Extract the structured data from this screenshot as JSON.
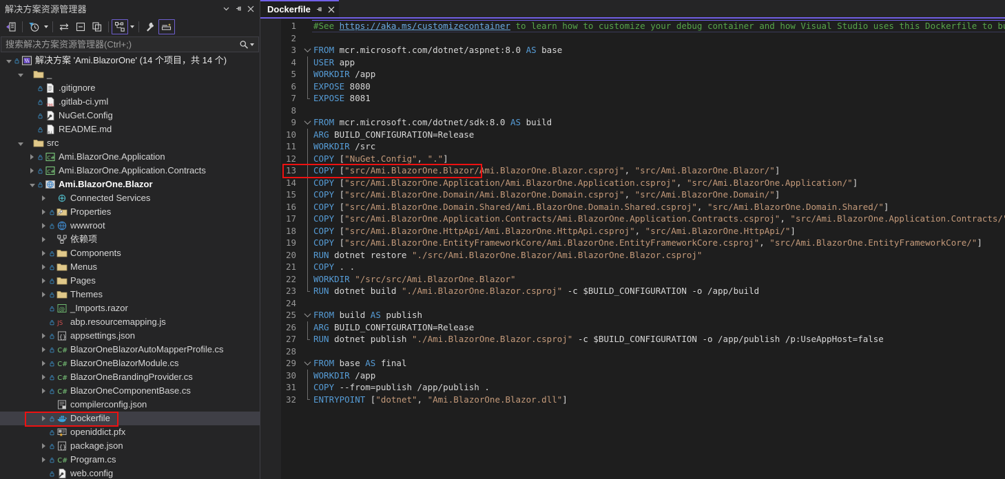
{
  "solution_explorer": {
    "title": "解决方案资源管理器",
    "titlebar_buttons": [
      {
        "name": "dropdown-icon",
        "glyph": "▾"
      },
      {
        "name": "pin-icon",
        "glyph": "⇥"
      },
      {
        "name": "close-icon",
        "glyph": "✕"
      }
    ],
    "toolbar": [
      {
        "name": "back-navigate-icon",
        "label": "后退"
      },
      {
        "name": "pending-changes-icon",
        "label": "挂起的更改筛选器"
      },
      {
        "name": "pending-changes-caret",
        "label": "筛选器下拉"
      },
      {
        "name": "sync-with-active-document-icon",
        "label": "与活动文档同步"
      },
      {
        "name": "collapse-all-icon",
        "label": "全部折叠"
      },
      {
        "name": "show-all-files-icon",
        "label": "显示所有文件"
      },
      {
        "name": "view-switcher-icon",
        "label": "切换视图"
      },
      {
        "name": "view-switcher-caret",
        "label": "视图下拉"
      },
      {
        "name": "properties-icon",
        "label": "属性"
      },
      {
        "name": "preview-selected-items-icon",
        "label": "预览选定项"
      }
    ],
    "search": {
      "placeholder": "搜索解决方案资源管理器(Ctrl+;)",
      "value": ""
    },
    "tree": [
      {
        "depth": 0,
        "expander": "open",
        "lock": true,
        "icon": "solution-icon",
        "label": "解决方案 'Ami.BlazorOne' (14 个项目，共 14 个)",
        "bold": false,
        "selected": false
      },
      {
        "depth": 1,
        "expander": "open",
        "lock": false,
        "icon": "folder-icon",
        "label": "_",
        "bold": false,
        "selected": false
      },
      {
        "depth": 2,
        "expander": "none",
        "lock": true,
        "icon": "file-icon",
        "label": ".gitignore",
        "bold": false,
        "selected": false
      },
      {
        "depth": 2,
        "expander": "none",
        "lock": true,
        "icon": "yml-icon",
        "label": ".gitlab-ci.yml",
        "bold": false,
        "selected": false
      },
      {
        "depth": 2,
        "expander": "none",
        "lock": true,
        "icon": "config-icon",
        "label": "NuGet.Config",
        "bold": false,
        "selected": false
      },
      {
        "depth": 2,
        "expander": "none",
        "lock": true,
        "icon": "md-icon",
        "label": "README.md",
        "bold": false,
        "selected": false
      },
      {
        "depth": 1,
        "expander": "open",
        "lock": false,
        "icon": "folder-icon",
        "label": "src",
        "bold": false,
        "selected": false
      },
      {
        "depth": 2,
        "expander": "closed",
        "lock": true,
        "icon": "csharp-proj-icon",
        "label": "Ami.BlazorOne.Application",
        "bold": false,
        "selected": false
      },
      {
        "depth": 2,
        "expander": "closed",
        "lock": true,
        "icon": "csharp-proj-icon",
        "label": "Ami.BlazorOne.Application.Contracts",
        "bold": false,
        "selected": false
      },
      {
        "depth": 2,
        "expander": "open",
        "lock": true,
        "icon": "web-proj-icon",
        "label": "Ami.BlazorOne.Blazor",
        "bold": true,
        "selected": false
      },
      {
        "depth": 3,
        "expander": "closed",
        "lock": false,
        "icon": "connected-services-icon",
        "label": "Connected Services",
        "bold": false,
        "selected": false
      },
      {
        "depth": 3,
        "expander": "closed",
        "lock": true,
        "icon": "properties-folder-icon",
        "label": "Properties",
        "bold": false,
        "selected": false
      },
      {
        "depth": 3,
        "expander": "closed",
        "lock": true,
        "icon": "globe-icon",
        "label": "wwwroot",
        "bold": false,
        "selected": false
      },
      {
        "depth": 3,
        "expander": "closed",
        "lock": false,
        "icon": "dependencies-icon",
        "label": "依赖项",
        "bold": false,
        "selected": false
      },
      {
        "depth": 3,
        "expander": "closed",
        "lock": true,
        "icon": "folder-icon",
        "label": "Components",
        "bold": false,
        "selected": false
      },
      {
        "depth": 3,
        "expander": "closed",
        "lock": true,
        "icon": "folder-icon",
        "label": "Menus",
        "bold": false,
        "selected": false
      },
      {
        "depth": 3,
        "expander": "closed",
        "lock": true,
        "icon": "folder-icon",
        "label": "Pages",
        "bold": false,
        "selected": false
      },
      {
        "depth": 3,
        "expander": "closed",
        "lock": true,
        "icon": "folder-icon",
        "label": "Themes",
        "bold": false,
        "selected": false
      },
      {
        "depth": 3,
        "expander": "none",
        "lock": true,
        "icon": "razor-icon",
        "label": "_Imports.razor",
        "bold": false,
        "selected": false
      },
      {
        "depth": 3,
        "expander": "none",
        "lock": true,
        "icon": "js-icon",
        "label": "abp.resourcemapping.js",
        "bold": false,
        "selected": false
      },
      {
        "depth": 3,
        "expander": "closed",
        "lock": true,
        "icon": "json-icon",
        "label": "appsettings.json",
        "bold": false,
        "selected": false
      },
      {
        "depth": 3,
        "expander": "closed",
        "lock": true,
        "icon": "csharp-file-icon",
        "label": "BlazorOneBlazorAutoMapperProfile.cs",
        "bold": false,
        "selected": false
      },
      {
        "depth": 3,
        "expander": "closed",
        "lock": true,
        "icon": "csharp-file-icon",
        "label": "BlazorOneBlazorModule.cs",
        "bold": false,
        "selected": false
      },
      {
        "depth": 3,
        "expander": "closed",
        "lock": true,
        "icon": "csharp-file-icon",
        "label": "BlazorOneBrandingProvider.cs",
        "bold": false,
        "selected": false
      },
      {
        "depth": 3,
        "expander": "closed",
        "lock": true,
        "icon": "csharp-file-icon",
        "label": "BlazorOneComponentBase.cs",
        "bold": false,
        "selected": false
      },
      {
        "depth": 3,
        "expander": "none",
        "lock": false,
        "icon": "compilerconfig-icon",
        "label": "compilerconfig.json",
        "bold": false,
        "selected": false
      },
      {
        "depth": 3,
        "expander": "closed",
        "lock": true,
        "icon": "docker-icon",
        "label": "Dockerfile",
        "bold": false,
        "selected": true
      },
      {
        "depth": 3,
        "expander": "none",
        "lock": true,
        "icon": "certificate-icon",
        "label": "openiddict.pfx",
        "bold": false,
        "selected": false
      },
      {
        "depth": 3,
        "expander": "closed",
        "lock": true,
        "icon": "json-icon",
        "label": "package.json",
        "bold": false,
        "selected": false
      },
      {
        "depth": 3,
        "expander": "closed",
        "lock": true,
        "icon": "csharp-file-icon",
        "label": "Program.cs",
        "bold": false,
        "selected": false
      },
      {
        "depth": 3,
        "expander": "none",
        "lock": true,
        "icon": "config-icon",
        "label": "web.config",
        "bold": false,
        "selected": false
      }
    ]
  },
  "editor": {
    "tab": {
      "label": "Dockerfile",
      "pin_icon": "pin-icon",
      "close_icon": "close-icon"
    },
    "accent_color": "#7160e8",
    "highlight_color": "#ee1111",
    "lines": [
      {
        "n": 1,
        "fold": "none",
        "tokens": [
          {
            "t": "#See ",
            "c": "cmt"
          },
          {
            "t": "https://aka.ms/customizecontainer",
            "c": "lnk"
          },
          {
            "t": " to learn how to customize your debug container and how Visual Studio uses this Dockerfile to build",
            "c": "cmt"
          }
        ]
      },
      {
        "n": 2,
        "fold": "none",
        "tokens": []
      },
      {
        "n": 3,
        "fold": "open",
        "tokens": [
          {
            "t": "FROM",
            "c": "kw"
          },
          {
            "t": " mcr.microsoft.com/dotnet/aspnet:8.0 ",
            "c": "plain"
          },
          {
            "t": "AS",
            "c": "kw"
          },
          {
            "t": " base",
            "c": "plain"
          }
        ]
      },
      {
        "n": 4,
        "fold": "bar",
        "tokens": [
          {
            "t": "USER",
            "c": "kw"
          },
          {
            "t": " app",
            "c": "plain"
          }
        ]
      },
      {
        "n": 5,
        "fold": "bar",
        "tokens": [
          {
            "t": "WORKDIR",
            "c": "kw"
          },
          {
            "t": " /app",
            "c": "plain"
          }
        ]
      },
      {
        "n": 6,
        "fold": "bar",
        "tokens": [
          {
            "t": "EXPOSE",
            "c": "kw"
          },
          {
            "t": " 8080",
            "c": "plain"
          }
        ]
      },
      {
        "n": 7,
        "fold": "barend",
        "tokens": [
          {
            "t": "EXPOSE",
            "c": "kw"
          },
          {
            "t": " 8081",
            "c": "plain"
          }
        ]
      },
      {
        "n": 8,
        "fold": "none",
        "tokens": []
      },
      {
        "n": 9,
        "fold": "open",
        "tokens": [
          {
            "t": "FROM",
            "c": "kw"
          },
          {
            "t": " mcr.microsoft.com/dotnet/sdk:8.0 ",
            "c": "plain"
          },
          {
            "t": "AS",
            "c": "kw"
          },
          {
            "t": " build",
            "c": "plain"
          }
        ]
      },
      {
        "n": 10,
        "fold": "bar",
        "tokens": [
          {
            "t": "ARG",
            "c": "kw"
          },
          {
            "t": " BUILD_CONFIGURATION=Release",
            "c": "plain"
          }
        ]
      },
      {
        "n": 11,
        "fold": "bar",
        "tokens": [
          {
            "t": "WORKDIR",
            "c": "kw"
          },
          {
            "t": " /src",
            "c": "plain"
          }
        ]
      },
      {
        "n": 12,
        "fold": "bar",
        "tokens": [
          {
            "t": "COPY",
            "c": "kw"
          },
          {
            "t": " [",
            "c": "plain"
          },
          {
            "t": "\"NuGet.Config\"",
            "c": "str"
          },
          {
            "t": ", ",
            "c": "plain"
          },
          {
            "t": "\".\"",
            "c": "str"
          },
          {
            "t": "]",
            "c": "plain"
          }
        ]
      },
      {
        "n": 13,
        "fold": "bar",
        "tokens": [
          {
            "t": "COPY",
            "c": "kw"
          },
          {
            "t": " [",
            "c": "plain"
          },
          {
            "t": "\"src/Ami.BlazorOne.Blazor/Ami.BlazorOne.Blazor.csproj\"",
            "c": "str"
          },
          {
            "t": ", ",
            "c": "plain"
          },
          {
            "t": "\"src/Ami.BlazorOne.Blazor/\"",
            "c": "str"
          },
          {
            "t": "]",
            "c": "plain"
          }
        ]
      },
      {
        "n": 14,
        "fold": "bar",
        "tokens": [
          {
            "t": "COPY",
            "c": "kw"
          },
          {
            "t": " [",
            "c": "plain"
          },
          {
            "t": "\"src/Ami.BlazorOne.Application/Ami.BlazorOne.Application.csproj\"",
            "c": "str"
          },
          {
            "t": ", ",
            "c": "plain"
          },
          {
            "t": "\"src/Ami.BlazorOne.Application/\"",
            "c": "str"
          },
          {
            "t": "]",
            "c": "plain"
          }
        ]
      },
      {
        "n": 15,
        "fold": "bar",
        "tokens": [
          {
            "t": "COPY",
            "c": "kw"
          },
          {
            "t": " [",
            "c": "plain"
          },
          {
            "t": "\"src/Ami.BlazorOne.Domain/Ami.BlazorOne.Domain.csproj\"",
            "c": "str"
          },
          {
            "t": ", ",
            "c": "plain"
          },
          {
            "t": "\"src/Ami.BlazorOne.Domain/\"",
            "c": "str"
          },
          {
            "t": "]",
            "c": "plain"
          }
        ]
      },
      {
        "n": 16,
        "fold": "bar",
        "tokens": [
          {
            "t": "COPY",
            "c": "kw"
          },
          {
            "t": " [",
            "c": "plain"
          },
          {
            "t": "\"src/Ami.BlazorOne.Domain.Shared/Ami.BlazorOne.Domain.Shared.csproj\"",
            "c": "str"
          },
          {
            "t": ", ",
            "c": "plain"
          },
          {
            "t": "\"src/Ami.BlazorOne.Domain.Shared/\"",
            "c": "str"
          },
          {
            "t": "]",
            "c": "plain"
          }
        ]
      },
      {
        "n": 17,
        "fold": "bar",
        "tokens": [
          {
            "t": "COPY",
            "c": "kw"
          },
          {
            "t": " [",
            "c": "plain"
          },
          {
            "t": "\"src/Ami.BlazorOne.Application.Contracts/Ami.BlazorOne.Application.Contracts.csproj\"",
            "c": "str"
          },
          {
            "t": ", ",
            "c": "plain"
          },
          {
            "t": "\"src/Ami.BlazorOne.Application.Contracts/\"",
            "c": "str"
          },
          {
            "t": "]",
            "c": "plain"
          }
        ]
      },
      {
        "n": 18,
        "fold": "bar",
        "tokens": [
          {
            "t": "COPY",
            "c": "kw"
          },
          {
            "t": " [",
            "c": "plain"
          },
          {
            "t": "\"src/Ami.BlazorOne.HttpApi/Ami.BlazorOne.HttpApi.csproj\"",
            "c": "str"
          },
          {
            "t": ", ",
            "c": "plain"
          },
          {
            "t": "\"src/Ami.BlazorOne.HttpApi/\"",
            "c": "str"
          },
          {
            "t": "]",
            "c": "plain"
          }
        ]
      },
      {
        "n": 19,
        "fold": "bar",
        "tokens": [
          {
            "t": "COPY",
            "c": "kw"
          },
          {
            "t": " [",
            "c": "plain"
          },
          {
            "t": "\"src/Ami.BlazorOne.EntityFrameworkCore/Ami.BlazorOne.EntityFrameworkCore.csproj\"",
            "c": "str"
          },
          {
            "t": ", ",
            "c": "plain"
          },
          {
            "t": "\"src/Ami.BlazorOne.EntityFrameworkCore/\"",
            "c": "str"
          },
          {
            "t": "]",
            "c": "plain"
          }
        ]
      },
      {
        "n": 20,
        "fold": "bar",
        "tokens": [
          {
            "t": "RUN",
            "c": "kw"
          },
          {
            "t": " dotnet restore ",
            "c": "plain"
          },
          {
            "t": "\"./src/Ami.BlazorOne.Blazor/Ami.BlazorOne.Blazor.csproj\"",
            "c": "str"
          }
        ]
      },
      {
        "n": 21,
        "fold": "bar",
        "tokens": [
          {
            "t": "COPY",
            "c": "kw"
          },
          {
            "t": " . .",
            "c": "plain"
          }
        ]
      },
      {
        "n": 22,
        "fold": "bar",
        "tokens": [
          {
            "t": "WORKDIR",
            "c": "kw"
          },
          {
            "t": " ",
            "c": "plain"
          },
          {
            "t": "\"/src/src/Ami.BlazorOne.Blazor\"",
            "c": "str"
          }
        ]
      },
      {
        "n": 23,
        "fold": "barend",
        "tokens": [
          {
            "t": "RUN",
            "c": "kw"
          },
          {
            "t": " dotnet build ",
            "c": "plain"
          },
          {
            "t": "\"./Ami.BlazorOne.Blazor.csproj\"",
            "c": "str"
          },
          {
            "t": " -c $BUILD_CONFIGURATION -o /app/build",
            "c": "plain"
          }
        ]
      },
      {
        "n": 24,
        "fold": "none",
        "tokens": []
      },
      {
        "n": 25,
        "fold": "open",
        "tokens": [
          {
            "t": "FROM",
            "c": "kw"
          },
          {
            "t": " build ",
            "c": "plain"
          },
          {
            "t": "AS",
            "c": "kw"
          },
          {
            "t": " publish",
            "c": "plain"
          }
        ]
      },
      {
        "n": 26,
        "fold": "bar",
        "tokens": [
          {
            "t": "ARG",
            "c": "kw"
          },
          {
            "t": " BUILD_CONFIGURATION=Release",
            "c": "plain"
          }
        ]
      },
      {
        "n": 27,
        "fold": "barend",
        "tokens": [
          {
            "t": "RUN",
            "c": "kw"
          },
          {
            "t": " dotnet publish ",
            "c": "plain"
          },
          {
            "t": "\"./Ami.BlazorOne.Blazor.csproj\"",
            "c": "str"
          },
          {
            "t": " -c $BUILD_CONFIGURATION -o /app/publish /p:UseAppHost=false",
            "c": "plain"
          }
        ]
      },
      {
        "n": 28,
        "fold": "none",
        "tokens": []
      },
      {
        "n": 29,
        "fold": "open",
        "tokens": [
          {
            "t": "FROM",
            "c": "kw"
          },
          {
            "t": " base ",
            "c": "plain"
          },
          {
            "t": "AS",
            "c": "kw"
          },
          {
            "t": " final",
            "c": "plain"
          }
        ]
      },
      {
        "n": 30,
        "fold": "bar",
        "tokens": [
          {
            "t": "WORKDIR",
            "c": "kw"
          },
          {
            "t": " /app",
            "c": "plain"
          }
        ]
      },
      {
        "n": 31,
        "fold": "bar",
        "tokens": [
          {
            "t": "COPY",
            "c": "kw"
          },
          {
            "t": " --from=publish /app/publish .",
            "c": "plain"
          }
        ]
      },
      {
        "n": 32,
        "fold": "barend",
        "tokens": [
          {
            "t": "ENTRYPOINT",
            "c": "kw"
          },
          {
            "t": " [",
            "c": "plain"
          },
          {
            "t": "\"dotnet\"",
            "c": "str"
          },
          {
            "t": ", ",
            "c": "plain"
          },
          {
            "t": "\"Ami.BlazorOne.Blazor.dll\"",
            "c": "str"
          },
          {
            "t": "]",
            "c": "plain"
          }
        ]
      }
    ],
    "annotations": [
      {
        "name": "copy-nuget-config-highlight",
        "line": 12
      },
      {
        "name": "dockerfile-tree-highlight",
        "target": "Dockerfile"
      }
    ]
  }
}
